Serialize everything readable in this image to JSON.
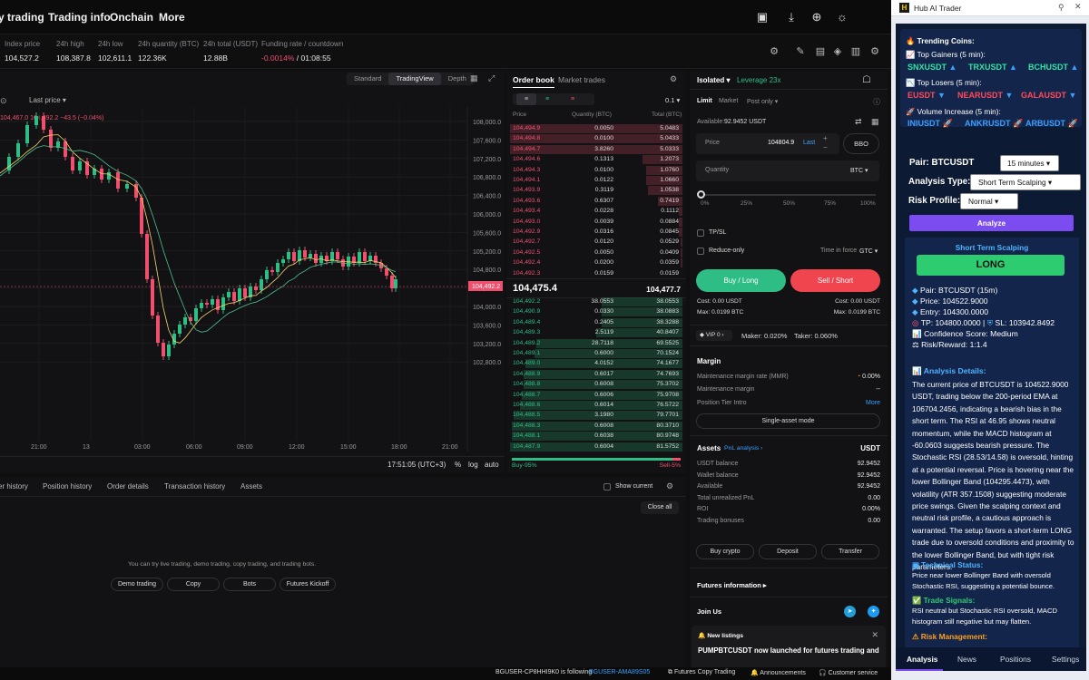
{
  "topnav": {
    "items": [
      "y trading",
      "Trading info",
      "Onchain",
      "More"
    ]
  },
  "stats": {
    "index_price_label": "Index price",
    "index_price": "104,527.2",
    "high_label": "24h high",
    "high": "108,387.8",
    "low_label": "24h low",
    "low": "102,611.1",
    "qty_label": "24h quantity (BTC)",
    "qty": "122.36K",
    "total_label": "24h total (USDT)",
    "total": "12.88B",
    "funding_label": "Funding rate / countdown",
    "funding_rate": "-0.0014%",
    "funding_countdown": "/ 01:08:55"
  },
  "chart": {
    "last_price_label": "Last price",
    "views": [
      "Standard",
      "TradingView",
      "Depth"
    ],
    "active_view": "TradingView",
    "legend": "104,467.0  104,492.2  −43.5 (−0.04%)",
    "price_ticks": [
      "108,000.0",
      "107,600.0",
      "107,200.0",
      "106,800.0",
      "106,400.0",
      "106,000.0",
      "105,600.0",
      "105,200.0",
      "104,800.0",
      "104,400.0",
      "104,000.0",
      "103,600.0",
      "103,200.0",
      "102,800.0"
    ],
    "current_price_tag": "104,492.2",
    "time_ticks": [
      "21:00",
      "13",
      "03:00",
      "06:00",
      "09:00",
      "12:00",
      "15:00",
      "18:00",
      "21:00"
    ],
    "clock": "17:51:05 (UTC+3)",
    "scale_opts": [
      "%",
      "log",
      "auto"
    ]
  },
  "orderbook": {
    "tabs": [
      "Order book",
      "Market trades"
    ],
    "precision": "0.1",
    "headers": [
      "Price",
      "Quantity (BTC)",
      "Total (BTC)"
    ],
    "asks": [
      [
        "104,494.9",
        "0.0050",
        "5.0483"
      ],
      [
        "104,494.8",
        "0.0100",
        "5.0433"
      ],
      [
        "104,494.7",
        "3.8260",
        "5.0333"
      ],
      [
        "104,494.6",
        "0.1313",
        "1.2073"
      ],
      [
        "104,494.3",
        "0.0100",
        "1.0760"
      ],
      [
        "104,494.1",
        "0.0122",
        "1.0660"
      ],
      [
        "104,493.9",
        "0.3119",
        "1.0538"
      ],
      [
        "104,493.6",
        "0.6307",
        "0.7419"
      ],
      [
        "104,493.4",
        "0.0228",
        "0.1112"
      ],
      [
        "104,493.0",
        "0.0039",
        "0.0884"
      ],
      [
        "104,492.9",
        "0.0316",
        "0.0845"
      ],
      [
        "104,492.7",
        "0.0120",
        "0.0529"
      ],
      [
        "104,492.5",
        "0.0050",
        "0.0409"
      ],
      [
        "104,492.4",
        "0.0200",
        "0.0359"
      ],
      [
        "104,492.3",
        "0.0159",
        "0.0159"
      ]
    ],
    "ask_depth": [
      1.0,
      1.0,
      1.0,
      0.23,
      0.21,
      0.21,
      0.2,
      0.14,
      0.02,
      0.02,
      0.02,
      0.01,
      0.01,
      0.01,
      0.0
    ],
    "mid_price": "104,475.4",
    "mark_price": "104,477.7",
    "bids": [
      [
        "104,492.2",
        "38.0553",
        "38.0553"
      ],
      [
        "104,490.9",
        "0.0330",
        "38.0883"
      ],
      [
        "104,489.4",
        "0.2405",
        "38.3288"
      ],
      [
        "104,489.3",
        "2.5119",
        "40.8407"
      ],
      [
        "104,489.2",
        "28.7118",
        "69.5525"
      ],
      [
        "104,489.1",
        "0.6000",
        "70.1524"
      ],
      [
        "104,489.0",
        "4.0152",
        "74.1677"
      ],
      [
        "104,488.9",
        "0.6017",
        "74.7693"
      ],
      [
        "104,488.8",
        "0.6008",
        "75.3702"
      ],
      [
        "104,488.7",
        "0.6006",
        "75.9708"
      ],
      [
        "104,488.6",
        "0.6014",
        "76.5722"
      ],
      [
        "104,488.5",
        "3.1980",
        "79.7701"
      ],
      [
        "104,488.3",
        "0.6008",
        "80.3710"
      ],
      [
        "104,488.1",
        "0.6038",
        "80.9748"
      ],
      [
        "104,487.9",
        "0.6004",
        "81.5752"
      ]
    ],
    "bid_depth": [
      0.47,
      0.47,
      0.47,
      0.5,
      0.85,
      0.86,
      0.91,
      0.92,
      0.92,
      0.93,
      0.94,
      0.98,
      0.99,
      0.99,
      1.0
    ],
    "buy_pct": "Buy-95%",
    "sell_pct": "Sell-5%"
  },
  "trade": {
    "margin_mode": "Isolated",
    "leverage": "Leverage 23x",
    "order_types": [
      "Limit",
      "Market",
      "Post only"
    ],
    "available_label": "Available:",
    "available": "92.9452 USDT",
    "price_label": "Price",
    "price_value": "104804.9",
    "price_last": "Last",
    "bbo": "BBO",
    "quantity_label": "Quantity",
    "quantity_unit": "BTC",
    "slider_marks": [
      "0%",
      "25%",
      "50%",
      "75%",
      "100%"
    ],
    "tpsl": "TP/SL",
    "reduce_only": "Reduce-only",
    "tif_label": "Time in force",
    "tif_value": "GTC",
    "buy_label": "Buy / Long",
    "sell_label": "Sell / Short",
    "buy_cost": "Cost: 0.00 USDT",
    "sell_cost": "Cost: 0.00 USDT",
    "buy_max": "Max: 0.0199 BTC",
    "sell_max": "Max: 0.0199 BTC",
    "vip": "VIP 0",
    "maker": "Maker: 0.020%",
    "taker": "Taker: 0.060%",
    "margin_title": "Margin",
    "mmr_label": "Maintenance margin rate (MMR)",
    "mmr_value": "0.00%",
    "mm_label": "Maintenance margin",
    "mm_value": "--",
    "tier_label": "Position Tier Intro",
    "tier_link": "More",
    "single_asset": "Single-asset mode",
    "assets_title": "Assets",
    "pnl_link": "PnL analysis",
    "assets_unit": "USDT",
    "asset_rows": [
      [
        "USDT balance",
        "92.9452"
      ],
      [
        "Wallet balance",
        "92.9452"
      ],
      [
        "Available",
        "92.9452"
      ],
      [
        "Total unrealized PnL",
        "0.00"
      ],
      [
        "ROI",
        "0.00%"
      ],
      [
        "Trading bonuses",
        "0.00"
      ]
    ],
    "asset_buttons": [
      "Buy crypto",
      "Deposit",
      "Transfer"
    ],
    "futures_info": "Futures information",
    "join_us": "Join Us",
    "new_listings": "New listings",
    "listing_text": "PUMPBTCUSDT now launched for futures trading and"
  },
  "bottom": {
    "tabs": [
      "er history",
      "Position history",
      "Order details",
      "Transaction history",
      "Assets"
    ],
    "show_current": "Show current",
    "close_all": "Close all",
    "empty_msg": "You can try live trading, demo trading, copy trading, and trading bots.",
    "buttons": [
      "Demo trading",
      "Copy",
      "Bots",
      "Futures Kickoff"
    ]
  },
  "footer": {
    "user": "BGUSER-CP8HHI9K0 is following",
    "following": "BGUSER-AMA89S05",
    "links": [
      "Futures Copy Trading",
      "Announcements",
      "Customer service"
    ]
  },
  "hub": {
    "title": "Hub AI Trader",
    "trending_title": "Trending Coins:",
    "gainers_title": "Top Gainers (5 min):",
    "gainers": [
      "SNXUSDT",
      "TRXUSDT",
      "BCHUSDT"
    ],
    "losers_title": "Top Losers (5 min):",
    "losers": [
      "EUSDT",
      "NEARUSDT",
      "GALAUSDT"
    ],
    "volume_title": "Volume Increase (5 min):",
    "volume": [
      "INIUSDT",
      "ANKRUSDT",
      "ARBUSDT"
    ],
    "pair_label": "Pair: BTCUSDT",
    "timeframe": "15 minutes",
    "analysis_type_label": "Analysis Type:",
    "analysis_type": "Short Term Scalping",
    "risk_label": "Risk Profile:",
    "risk": "Normal",
    "analyze_btn": "Analyze",
    "result_title": "Short Term Scalping",
    "signal": "LONG",
    "pair_line": "Pair: BTCUSDT (15m)",
    "price_line": "Price: 104522.9000",
    "entry_line": "Entry: 104300.0000",
    "tp_line": "TP: 104800.0000 |",
    "sl_line": "SL: 103942.8492",
    "confidence_line": "Confidence Score: Medium",
    "rr_line": "Risk/Reward: 1:1.4",
    "details_title": "Analysis Details:",
    "details_text": "The current price of BTCUSDT is 104522.9000 USDT, trading below the 200-period EMA at 106704.2456, indicating a bearish bias in the short term. The RSI at 46.95 shows neutral momentum, while the MACD histogram at -60.0603 suggests bearish pressure. The Stochastic RSI (28.53/14.58) is oversold, hinting at a potential reversal. Price is hovering near the lower Bollinger Band (104295.4473), with volatility (ATR 357.1508) suggesting moderate price swings. Given the scalping context and neutral risk profile, a cautious approach is warranted. The setup favors a short-term LONG trade due to oversold conditions and proximity to the lower Bollinger Band, but with tight risk parameters.",
    "tech_title": "Technical Status:",
    "tech_text": "Price near lower Bollinger Band with oversold Stochastic RSI, suggesting a potential bounce.",
    "signals_title": "Trade Signals:",
    "signals_text": "RSI neutral but Stochastic RSI oversold, MACD histogram still negative but may flatten.",
    "risk_mgmt_title": "Risk Management:",
    "tabs": [
      "Analysis",
      "News",
      "Positions",
      "Settings"
    ]
  }
}
